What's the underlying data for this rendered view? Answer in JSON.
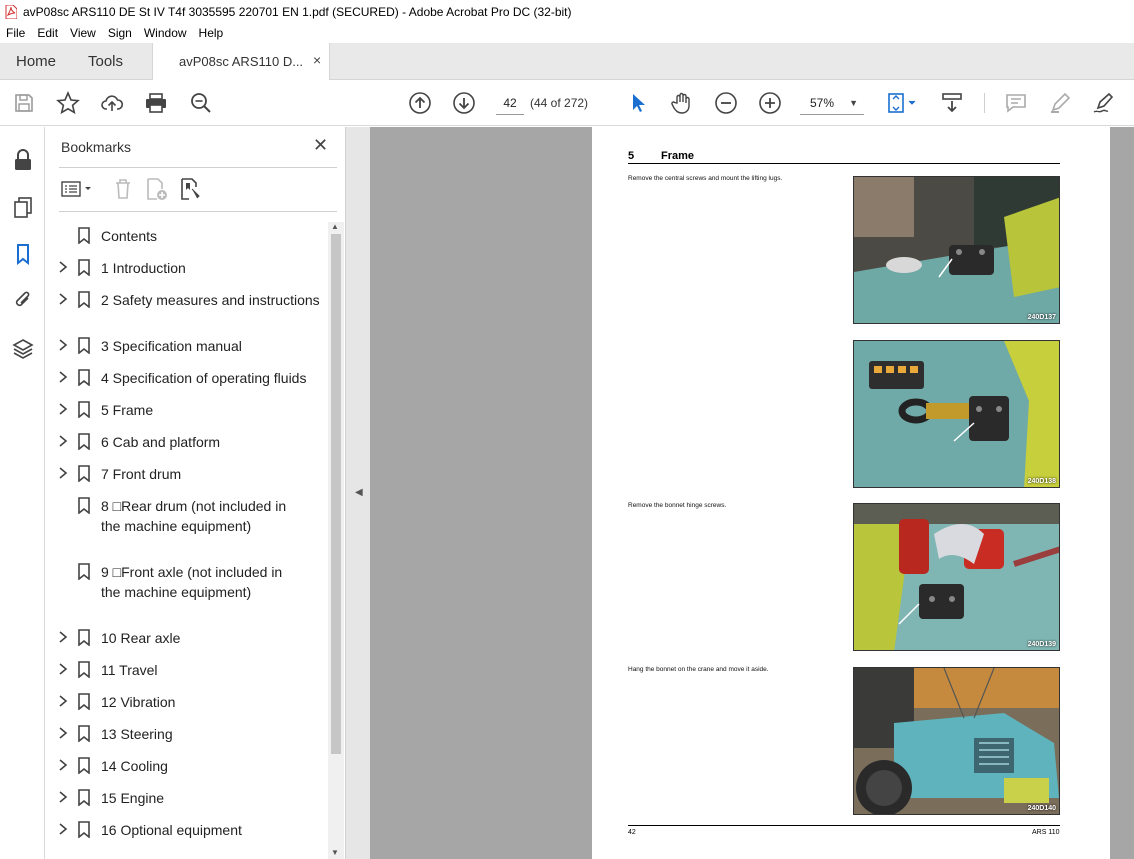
{
  "window": {
    "title": "avP08sc ARS110 DE St IV T4f 3035595 220701 EN 1.pdf (SECURED) - Adobe Acrobat Pro DC (32-bit)"
  },
  "menu": [
    "File",
    "Edit",
    "View",
    "Sign",
    "Window",
    "Help"
  ],
  "tabs": {
    "home": "Home",
    "tools": "Tools",
    "document": "avP08sc ARS110 D...",
    "close": "×"
  },
  "toolbar": {
    "page_number": "42",
    "page_count": "(44 of 272)",
    "zoom": "57%"
  },
  "bookmarks": {
    "header": "Bookmarks",
    "items": [
      {
        "label": "Contents",
        "expandable": false
      },
      {
        "label": "1 Introduction",
        "expandable": true
      },
      {
        "label": "2 Safety measures and instructions",
        "expandable": true
      },
      {
        "label": "3 Specification manual",
        "expandable": true
      },
      {
        "label": "4 Specification of operating fluids",
        "expandable": true
      },
      {
        "label": "5 Frame",
        "expandable": true
      },
      {
        "label": "6 Cab and platform",
        "expandable": true
      },
      {
        "label": "7 Front drum",
        "expandable": true
      },
      {
        "label": "8 □Rear drum (not included in the machine equipment)",
        "expandable": false
      },
      {
        "label": "9 □Front axle (not included in the machine equipment)",
        "expandable": false
      },
      {
        "label": "10 Rear axle",
        "expandable": true
      },
      {
        "label": "11 Travel",
        "expandable": true
      },
      {
        "label": "12 Vibration",
        "expandable": true
      },
      {
        "label": "13 Steering",
        "expandable": true
      },
      {
        "label": "14 Cooling",
        "expandable": true
      },
      {
        "label": "15 Engine",
        "expandable": true
      },
      {
        "label": "16 Optional equipment",
        "expandable": true
      }
    ]
  },
  "page": {
    "section_number": "5",
    "section_title": "Frame",
    "steps": [
      "Remove the central screws and mount the lifting lugs.",
      "Remove the bonnet hinge screws.",
      "Hang the bonnet on the crane and move it aside."
    ],
    "photos": [
      "240D137",
      "240D138",
      "240D139",
      "240D140"
    ],
    "footer_left": "42",
    "footer_right": "ARS 110"
  }
}
